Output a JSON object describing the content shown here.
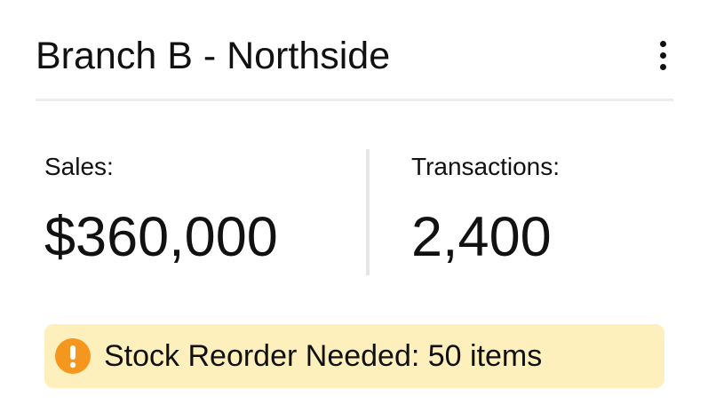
{
  "card": {
    "title": "Branch B - Northside",
    "menu_icon": "more-vertical-icon"
  },
  "metrics": {
    "sales": {
      "label": "Sales:",
      "value": "$360,000"
    },
    "transactions": {
      "label": "Transactions:",
      "value": "2,400"
    }
  },
  "alert": {
    "icon": "exclamation-circle-icon",
    "text": "Stock Reorder Needed: 50 items",
    "background_color": "#fdf0bd",
    "icon_color": "#f5961e"
  }
}
